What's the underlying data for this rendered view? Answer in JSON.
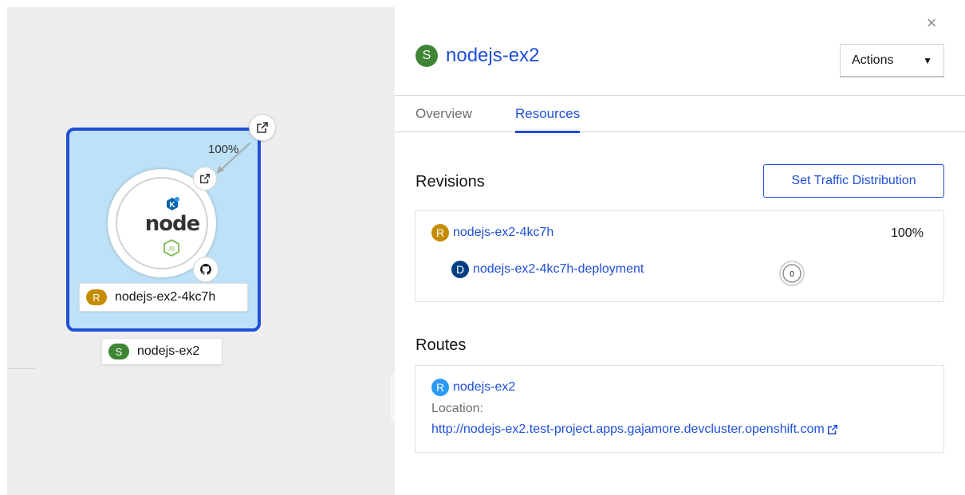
{
  "topology": {
    "traffic_percent": "100%",
    "revision_label": "nodejs-ex2-4kc7h",
    "revision_badge": "R",
    "service_label": "nodejs-ex2",
    "service_badge": "S",
    "node_logo_text": "node",
    "js_badge": "JS",
    "knative_badge": "K"
  },
  "panel": {
    "close_glyph": "×",
    "title_badge": "S",
    "title": "nodejs-ex2",
    "actions_label": "Actions",
    "tabs": [
      {
        "label": "Overview",
        "active": false
      },
      {
        "label": "Resources",
        "active": true
      }
    ],
    "revisions": {
      "heading": "Revisions",
      "button_label": "Set Traffic Distribution",
      "items": [
        {
          "badge": "R",
          "name": "nodejs-ex2-4kc7h",
          "traffic": "100%",
          "deployment": {
            "badge": "D",
            "name": "nodejs-ex2-4kc7h-deployment",
            "pods": "0"
          }
        }
      ]
    },
    "routes": {
      "heading": "Routes",
      "items": [
        {
          "badge": "R",
          "name": "nodejs-ex2",
          "location_label": "Location:",
          "url": "http://nodejs-ex2.test-project.apps.gajamore.devcluster.openshift.com"
        }
      ]
    }
  },
  "colors": {
    "link": "#1f4fd6",
    "revision_badge": "#c58c00",
    "service_badge": "#3e8635",
    "deployment_badge": "#004080",
    "route_badge": "#2b9af3",
    "selection_border": "#1f4fd6",
    "selection_fill": "#bde2f7"
  }
}
